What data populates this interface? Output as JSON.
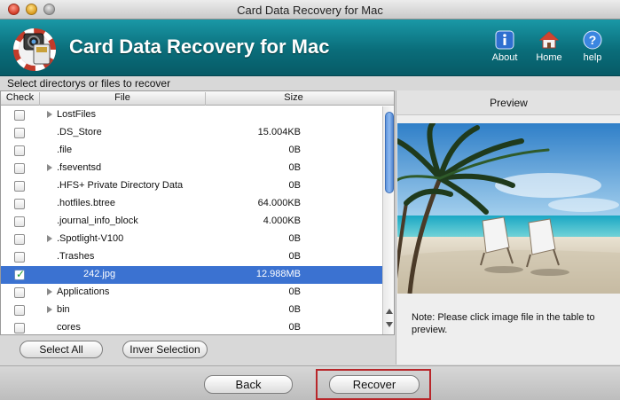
{
  "window": {
    "title": "Card Data Recovery for Mac"
  },
  "header": {
    "app_title": "Card Data Recovery for Mac",
    "buttons": {
      "about": "About",
      "home": "Home",
      "help": "help"
    }
  },
  "section_label": "Select directorys or files to recover",
  "table": {
    "columns": {
      "check": "Check",
      "file": "File",
      "size": "Size"
    },
    "rows": [
      {
        "name": "LostFiles",
        "size": "",
        "expandable": true,
        "checked": false,
        "selected": false
      },
      {
        "name": ".DS_Store",
        "size": "15.004KB",
        "expandable": false,
        "checked": false,
        "selected": false
      },
      {
        "name": ".file",
        "size": "0B",
        "expandable": false,
        "checked": false,
        "selected": false
      },
      {
        "name": ".fseventsd",
        "size": "0B",
        "expandable": true,
        "checked": false,
        "selected": false
      },
      {
        "name": ".HFS+ Private Directory Data",
        "size": "0B",
        "expandable": false,
        "checked": false,
        "selected": false
      },
      {
        "name": ".hotfiles.btree",
        "size": "64.000KB",
        "expandable": false,
        "checked": false,
        "selected": false
      },
      {
        "name": ".journal_info_block",
        "size": "4.000KB",
        "expandable": false,
        "checked": false,
        "selected": false
      },
      {
        "name": ".Spotlight-V100",
        "size": "0B",
        "expandable": true,
        "checked": false,
        "selected": false
      },
      {
        "name": ".Trashes",
        "size": "0B",
        "expandable": false,
        "checked": false,
        "selected": false
      },
      {
        "name": "242.jpg",
        "size": "12.988MB",
        "expandable": false,
        "checked": true,
        "selected": true,
        "indent": true
      },
      {
        "name": "Applications",
        "size": "0B",
        "expandable": true,
        "checked": false,
        "selected": false
      },
      {
        "name": "bin",
        "size": "0B",
        "expandable": true,
        "checked": false,
        "selected": false
      },
      {
        "name": "cores",
        "size": "0B",
        "expandable": false,
        "checked": false,
        "selected": false
      }
    ]
  },
  "table_buttons": {
    "select_all": "Select All",
    "inverse": "Inver Selection"
  },
  "preview": {
    "title": "Preview",
    "note": "Note: Please click image file in the table to preview."
  },
  "footer": {
    "back": "Back",
    "recover": "Recover"
  },
  "colors": {
    "banner": "#0a6d7a",
    "selection": "#3b72d1",
    "highlight_frame": "#b8262a"
  }
}
